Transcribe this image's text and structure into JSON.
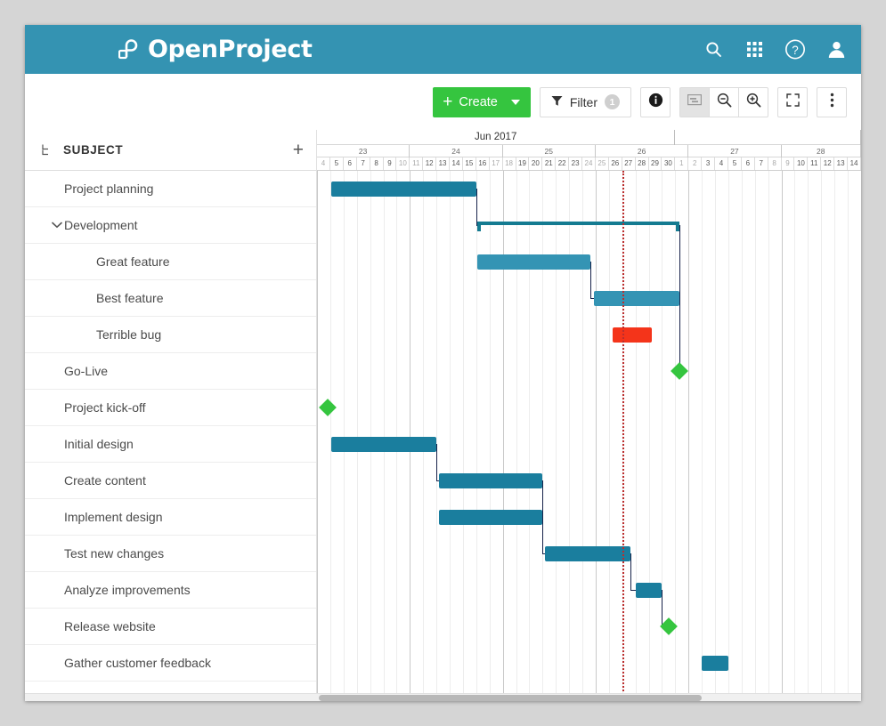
{
  "app": {
    "brand": "OpenProject",
    "logo_icon": "openproject-logo-icon"
  },
  "header_icons": [
    {
      "name": "search-icon",
      "glyph": "search"
    },
    {
      "name": "grid-modules-icon",
      "glyph": "grid"
    },
    {
      "name": "help-icon",
      "glyph": "question-circle"
    },
    {
      "name": "user-avatar-icon",
      "glyph": "user"
    }
  ],
  "toolbar": {
    "create_label": "Create",
    "create_plus": "+",
    "filter_label": "Filter",
    "filter_count": "1",
    "buttons": [
      {
        "name": "info-button",
        "icon": "info-icon"
      },
      {
        "name": "gantt-view-button",
        "icon": "gantt-chart-icon",
        "active": true
      },
      {
        "name": "zoom-out-button",
        "icon": "zoom-out-icon"
      },
      {
        "name": "zoom-in-button",
        "icon": "zoom-in-icon"
      },
      {
        "name": "fullscreen-button",
        "icon": "expand-icon"
      },
      {
        "name": "more-menu-button",
        "icon": "kebab-menu-icon"
      }
    ]
  },
  "table": {
    "column_header": "SUBJECT",
    "hierarchy_icon": "hierarchy-icon",
    "add_column_label": "+",
    "rows": [
      {
        "label": "Project planning",
        "level": 0,
        "collapsible": false
      },
      {
        "label": "Development",
        "level": 0,
        "collapsible": true,
        "expanded": true
      },
      {
        "label": "Great feature",
        "level": 2,
        "collapsible": false
      },
      {
        "label": "Best feature",
        "level": 2,
        "collapsible": false
      },
      {
        "label": "Terrible bug",
        "level": 2,
        "collapsible": false
      },
      {
        "label": "Go-Live",
        "level": 0,
        "collapsible": false
      },
      {
        "label": "Project kick-off",
        "level": 0,
        "collapsible": false
      },
      {
        "label": "Initial design",
        "level": 0,
        "collapsible": false
      },
      {
        "label": "Create content",
        "level": 0,
        "collapsible": false
      },
      {
        "label": "Implement design",
        "level": 0,
        "collapsible": false
      },
      {
        "label": "Test new changes",
        "level": 0,
        "collapsible": false
      },
      {
        "label": "Analyze improvements",
        "level": 0,
        "collapsible": false
      },
      {
        "label": "Release website",
        "level": 0,
        "collapsible": false
      },
      {
        "label": "Gather customer feedback",
        "level": 0,
        "collapsible": false
      }
    ]
  },
  "chart_data": {
    "type": "gantt",
    "title": "Jun 2017",
    "months": [
      {
        "label": "Jun 2017",
        "start_day_index": 0,
        "span_days": 27
      },
      {
        "label": "",
        "start_day_index": 27,
        "span_days": 14
      }
    ],
    "weeks": [
      {
        "label": "23",
        "start_day_index": 0,
        "span_days": 7
      },
      {
        "label": "24",
        "start_day_index": 7,
        "span_days": 7
      },
      {
        "label": "25",
        "start_day_index": 14,
        "span_days": 7
      },
      {
        "label": "26",
        "start_day_index": 21,
        "span_days": 7
      },
      {
        "label": "27",
        "start_day_index": 28,
        "span_days": 7
      },
      {
        "label": "28",
        "start_day_index": 35,
        "span_days": 6
      }
    ],
    "day_labels": [
      "4",
      "5",
      "6",
      "7",
      "8",
      "9",
      "10",
      "11",
      "12",
      "13",
      "14",
      "15",
      "16",
      "17",
      "18",
      "19",
      "20",
      "21",
      "22",
      "23",
      "24",
      "25",
      "26",
      "27",
      "28",
      "29",
      "30",
      "1",
      "2",
      "3",
      "4",
      "5",
      "6",
      "7",
      "8",
      "9",
      "10",
      "11",
      "12",
      "13",
      "14"
    ],
    "weekend_day_indices": [
      0,
      6,
      7,
      13,
      14,
      20,
      21,
      27,
      28,
      34,
      35
    ],
    "today_day_index": 23,
    "colors": {
      "bar": "#1a7e9e",
      "bar_light": "#3494b4",
      "bar_red": "#f4341a",
      "milestone": "#35c53f",
      "summary": "#147b91",
      "relation": "#17224a",
      "today": "#bb2d2d",
      "brand": "#3493b2",
      "create": "#35c53f"
    },
    "tasks": [
      {
        "row": 0,
        "name": "Project planning",
        "kind": "bar",
        "start_day_index": 1.1,
        "end_day_index": 12.0,
        "color": "bar"
      },
      {
        "row": 1,
        "name": "Development",
        "kind": "summary",
        "start_day_index": 12.1,
        "end_day_index": 27.3,
        "color": "summary"
      },
      {
        "row": 2,
        "name": "Great feature",
        "kind": "bar",
        "start_day_index": 12.1,
        "end_day_index": 20.6,
        "color": "bar_light"
      },
      {
        "row": 3,
        "name": "Best feature",
        "kind": "bar",
        "start_day_index": 20.9,
        "end_day_index": 27.3,
        "color": "bar_light"
      },
      {
        "row": 4,
        "name": "Terrible bug",
        "kind": "bar",
        "start_day_index": 22.3,
        "end_day_index": 25.2,
        "color": "bar_red"
      },
      {
        "row": 5,
        "name": "Go-Live",
        "kind": "milestone",
        "start_day_index": 27.3,
        "color": "milestone"
      },
      {
        "row": 6,
        "name": "Project kick-off",
        "kind": "milestone",
        "start_day_index": 0.8,
        "color": "milestone"
      },
      {
        "row": 7,
        "name": "Initial design",
        "kind": "bar",
        "start_day_index": 1.1,
        "end_day_index": 9.0,
        "color": "bar"
      },
      {
        "row": 8,
        "name": "Create content",
        "kind": "bar",
        "start_day_index": 9.2,
        "end_day_index": 17.0,
        "color": "bar"
      },
      {
        "row": 9,
        "name": "Implement design",
        "kind": "bar",
        "start_day_index": 9.2,
        "end_day_index": 17.0,
        "color": "bar"
      },
      {
        "row": 10,
        "name": "Test new changes",
        "kind": "bar",
        "start_day_index": 17.2,
        "end_day_index": 23.6,
        "color": "bar"
      },
      {
        "row": 11,
        "name": "Analyze improvements",
        "kind": "bar",
        "start_day_index": 24.0,
        "end_day_index": 26.0,
        "color": "bar"
      },
      {
        "row": 12,
        "name": "Release website",
        "kind": "milestone",
        "start_day_index": 26.5,
        "color": "milestone"
      },
      {
        "row": 13,
        "name": "Gather customer feedback",
        "kind": "bar",
        "start_day_index": 29.0,
        "end_day_index": 31.0,
        "color": "bar"
      }
    ],
    "relations": [
      {
        "from_row": 0,
        "to_row": 1
      },
      {
        "from_row": 1,
        "to_row": 5
      },
      {
        "from_row": 2,
        "to_row": 3
      },
      {
        "from_row": 7,
        "to_row": 8
      },
      {
        "from_row": 8,
        "to_row": 9
      },
      {
        "from_row": 9,
        "to_row": 10
      },
      {
        "from_row": 10,
        "to_row": 11
      },
      {
        "from_row": 11,
        "to_row": 12
      }
    ]
  }
}
